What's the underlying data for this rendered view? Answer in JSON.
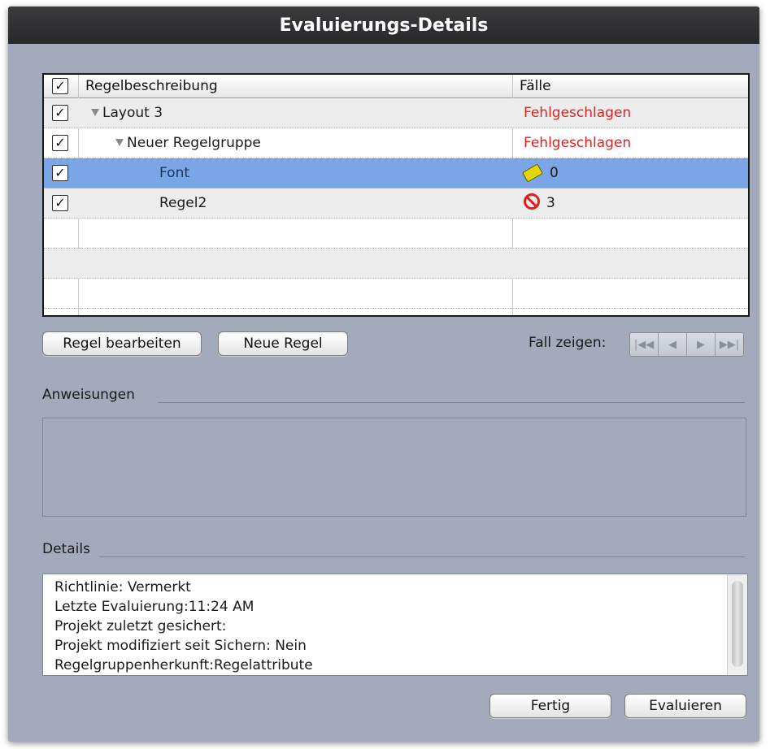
{
  "window": {
    "title": "Evaluierungs-Details"
  },
  "table": {
    "columns": {
      "check": "",
      "description": "Regelbeschreibung",
      "cases": "Fälle"
    },
    "rows": [
      {
        "label": "Layout 3",
        "cases": "Fehlgeschlagen",
        "status": "failed"
      },
      {
        "label": "Neuer Regelgruppe",
        "cases": "Fehlgeschlagen",
        "status": "failed"
      },
      {
        "label": "Font",
        "cases": "0",
        "icon": "note-icon"
      },
      {
        "label": "Regel2",
        "cases": "3",
        "icon": "forbidden-icon"
      }
    ]
  },
  "buttons": {
    "edit_rule": "Regel bearbeiten",
    "new_rule": "Neue Regel",
    "done": "Fertig",
    "evaluate": "Evaluieren"
  },
  "case_nav": {
    "label": "Fall zeigen:",
    "first": "|◀◀",
    "prev": "◀",
    "next": "▶",
    "last": "▶▶|"
  },
  "instructions": {
    "label": "Anweisungen",
    "text": ""
  },
  "details": {
    "label": "Details",
    "lines": [
      "Richtlinie: Vermerkt",
      "Letzte Evaluierung:11:24 AM",
      "Projekt zuletzt gesichert:",
      "Projekt modifiziert seit Sichern: Nein",
      "Regelgruppenherkunft:Regelattribute"
    ]
  },
  "colors": {
    "window_bg": "#a3aabb",
    "failed_text": "#dd2222",
    "selection": "#7aa6e8",
    "titlebar": "#2f2f31"
  }
}
